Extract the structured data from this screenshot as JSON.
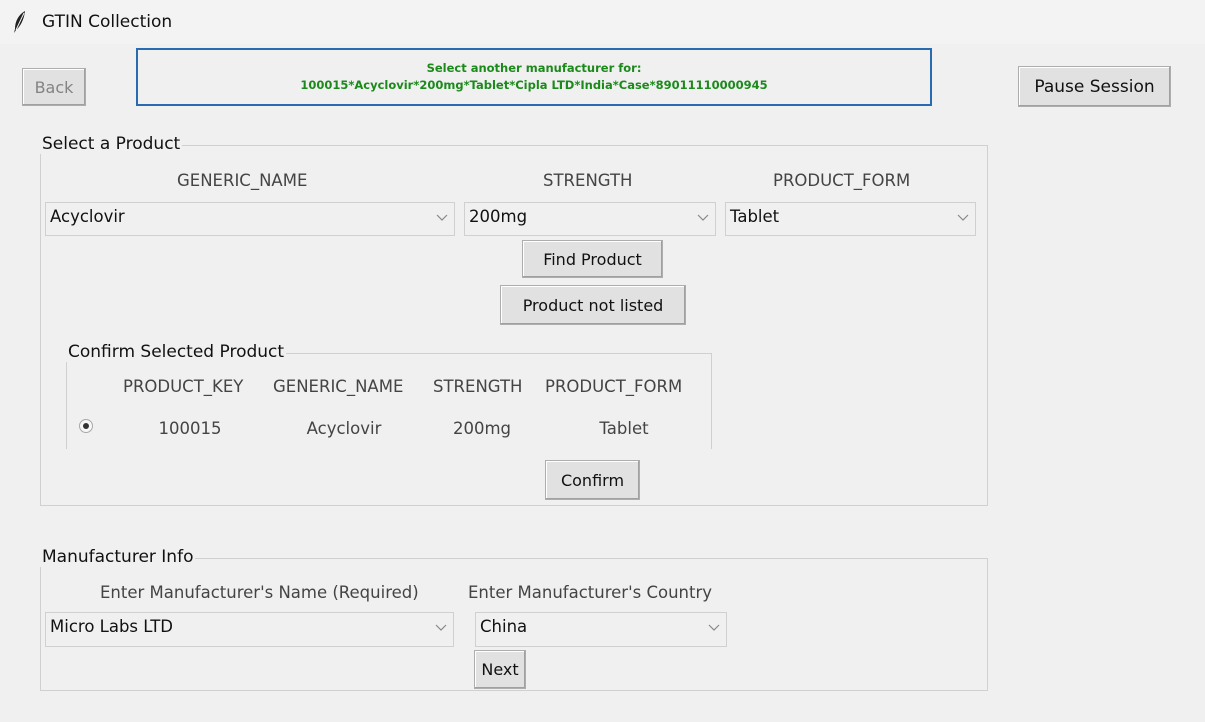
{
  "window": {
    "title": "GTIN Collection"
  },
  "header": {
    "back_label": "Back",
    "pause_label": "Pause Session",
    "banner_line1": "Select another manufacturer for:",
    "banner_line2": "100015*Acyclovir*200mg*Tablet*Cipla LTD*India*Case*89011110000945"
  },
  "select_product": {
    "legend": "Select a Product",
    "headers": {
      "generic_name": "GENERIC_NAME",
      "strength": "STRENGTH",
      "product_form": "PRODUCT_FORM"
    },
    "generic_name_value": "Acyclovir",
    "strength_value": "200mg",
    "product_form_value": "Tablet",
    "find_label": "Find Product",
    "not_listed_label": "Product not listed"
  },
  "confirm_product": {
    "legend": "Confirm Selected Product",
    "columns": [
      "PRODUCT_KEY",
      "GENERIC_NAME",
      "STRENGTH",
      "PRODUCT_FORM"
    ],
    "row": {
      "product_key": "100015",
      "generic_name": "Acyclovir",
      "strength": "200mg",
      "product_form": "Tablet",
      "selected": true
    },
    "confirm_label": "Confirm"
  },
  "manufacturer": {
    "legend": "Manufacturer Info",
    "name_label": "Enter Manufacturer's Name (Required)",
    "country_label": "Enter Manufacturer's Country",
    "name_value": "Micro Labs LTD",
    "country_value": "China",
    "next_label": "Next"
  },
  "icons": {
    "app": "feather-icon",
    "dropdown": "chevron-down-icon",
    "radio": "radio-selected-icon"
  }
}
